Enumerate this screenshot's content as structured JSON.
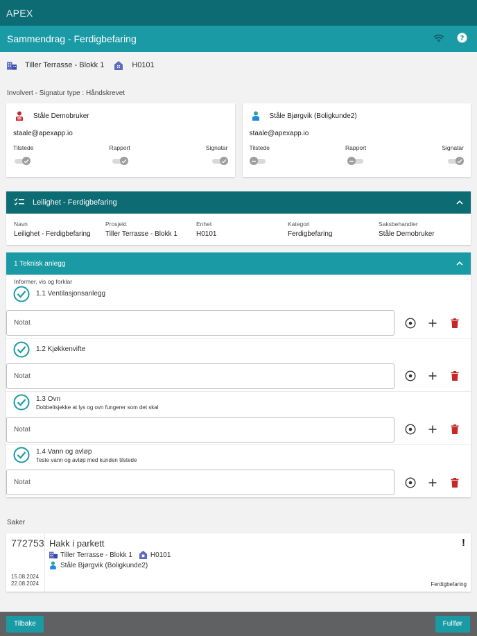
{
  "app": {
    "title": "APEX"
  },
  "subheader": {
    "title": "Sammendrag - Ferdigbefaring",
    "wifi_icon": "wifi-icon",
    "help_icon": "help-icon"
  },
  "location": {
    "project": "Tiller Terrasse - Blokk 1",
    "unit": "H0101"
  },
  "involved": {
    "label": "Involvert - Signatur type : Håndskrevet",
    "persons": [
      {
        "name": "Ståle Demobruker",
        "email": "staale@apexapp.io",
        "avatar_color": "#c62828",
        "toggles": [
          {
            "label": "Tilstede",
            "on": true
          },
          {
            "label": "Rapport",
            "on": true
          },
          {
            "label": "Signatar",
            "on": true
          }
        ]
      },
      {
        "name": "Ståle Bjørgvik (Boligkunde2)",
        "email": "staale@apexapp.io",
        "avatar_color": "#26a69a",
        "toggles": [
          {
            "label": "Tilstede",
            "on": false
          },
          {
            "label": "Rapport",
            "on": false
          },
          {
            "label": "Signatar",
            "on": true
          }
        ]
      }
    ]
  },
  "checklist": {
    "title": "Leilighet - Ferdigbefaring",
    "fields": [
      {
        "label": "Navn",
        "value": "Leilighet - Ferdigbefaring"
      },
      {
        "label": "Prosjekt",
        "value": "Tiller Terrasse - Blokk 1"
      },
      {
        "label": "Enhet",
        "value": "H0101"
      },
      {
        "label": "Kategori",
        "value": "Ferdigbefaring"
      },
      {
        "label": "Saksbehandler",
        "value": "Ståle Demobruker"
      }
    ]
  },
  "section": {
    "title": "1 Teknisk anlegg",
    "subtitle": "Informer, vis og forklar",
    "items": [
      {
        "title": "1.1 Ventilasjonsanlegg",
        "desc": "",
        "note_placeholder": "Notat"
      },
      {
        "title": "1.2 Kjøkkenvifte",
        "desc": "",
        "note_placeholder": "Notat"
      },
      {
        "title": "1.3 Ovn",
        "desc": "Dobbeltsjekke at lys og ovn fungerer som det skal",
        "note_placeholder": "Notat"
      },
      {
        "title": "1.4 Vann og avløp",
        "desc": "Teste vann og avløp med kunden tilstede",
        "note_placeholder": "Notat"
      }
    ]
  },
  "cases": {
    "label": "Saker",
    "items": [
      {
        "number": "772753",
        "title": "Hakk i parkett",
        "project": "Tiller Terrasse - Blokk 1",
        "unit": "H0101",
        "person": "Ståle Bjørgvik (Boligkunde2)",
        "date1": "15.08.2024",
        "date2": "22.08.2024",
        "type": "Ferdigbefaring",
        "priority": "!"
      }
    ]
  },
  "footer": {
    "back_label": "Tilbake",
    "finish_label": "Fullfør"
  },
  "colors": {
    "primary_dark": "#0d6b74",
    "primary": "#1a9aa4",
    "delete": "#c62828",
    "check": "#1a9aa4"
  }
}
